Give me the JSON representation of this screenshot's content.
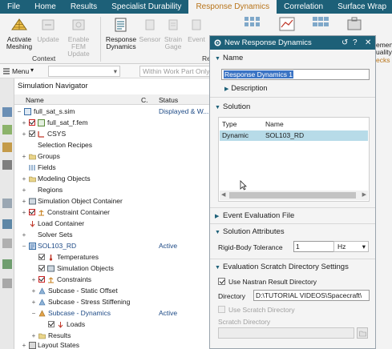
{
  "tabs": [
    "File",
    "Home",
    "Results",
    "Specialist Durability",
    "Response Dynamics",
    "Correlation",
    "Surface Wrap"
  ],
  "active_tab": "Response Dynamics",
  "ribbon": {
    "activate_meshing": "Activate",
    "activate_meshing2": "Meshing",
    "update": "Update",
    "enable_fem_update": "Enable FEM",
    "enable_fem_update2": "Update",
    "context_label": "Context",
    "response_dynamics": "Response",
    "response_dynamics2": "Dynamics",
    "sensor": "Sensor",
    "strain_gage": "Strain",
    "strain_gage2": "Gage",
    "event": "Event",
    "group_label_partial": "Re",
    "right_partial_1": "ement",
    "right_partial_2": "uality",
    "right_partial_3": "ecks a"
  },
  "toolbar": {
    "menu_label": "Menu",
    "menu_arrow": "▾",
    "filter_placeholder": "",
    "scope_placeholder": "Within Work Part Only"
  },
  "navigator": {
    "title": "Simulation Navigator",
    "col_name": "Name",
    "col_c": "C.",
    "col_status": "Status",
    "rows": [
      {
        "label": "full_sat_s.sim",
        "status": "Displayed & W..."
      },
      {
        "label": "full_sat_f.fem"
      },
      {
        "label": "CSYS"
      },
      {
        "label": "Selection Recipes"
      },
      {
        "label": "Groups"
      },
      {
        "label": "Fields"
      },
      {
        "label": "Modeling Objects"
      },
      {
        "label": "Regions"
      },
      {
        "label": "Simulation Object Container"
      },
      {
        "label": "Constraint Container"
      },
      {
        "label": "Load Container"
      },
      {
        "label": "Solver Sets"
      },
      {
        "label": "SOL103_RD",
        "status": "Active"
      },
      {
        "label": "Temperatures"
      },
      {
        "label": "Simulation Objects"
      },
      {
        "label": "Constraints"
      },
      {
        "label": "Subcase - Static Offset"
      },
      {
        "label": "Subcase - Stress Stiffening"
      },
      {
        "label": "Subcase - Dynamics",
        "status": "Active"
      },
      {
        "label": "Loads"
      },
      {
        "label": "Results"
      },
      {
        "label": "Layout States"
      }
    ]
  },
  "dialog": {
    "title": "New Response Dynamics",
    "section_name": "Name",
    "name_value": "Response Dynamics 1",
    "description_label": "Description",
    "section_solution": "Solution",
    "table_col_type": "Type",
    "table_col_name": "Name",
    "table_row_type": "Dynamic",
    "table_row_name": "SOL103_RD",
    "section_event": "Event Evaluation File",
    "section_attributes": "Solution Attributes",
    "rigid_body_label": "Rigid-Body Tolerance",
    "rigid_body_value": "1",
    "rigid_body_unit": "Hz",
    "section_scratch": "Evaluation Scratch Directory Settings",
    "use_nastran_label": "Use Nastran Result Directory",
    "directory_label": "Directory",
    "directory_value": "D:\\TUTORIAL VIDEOS\\Spacecraft\\",
    "use_scratch_label": "Use Scratch Directory",
    "scratch_dir_label": "Scratch Directory"
  },
  "colors": {
    "title_bar": "#1d6078",
    "active_tab_text": "#b8741a",
    "selection": "#b7dbe8",
    "status_text": "#1d4a86"
  }
}
